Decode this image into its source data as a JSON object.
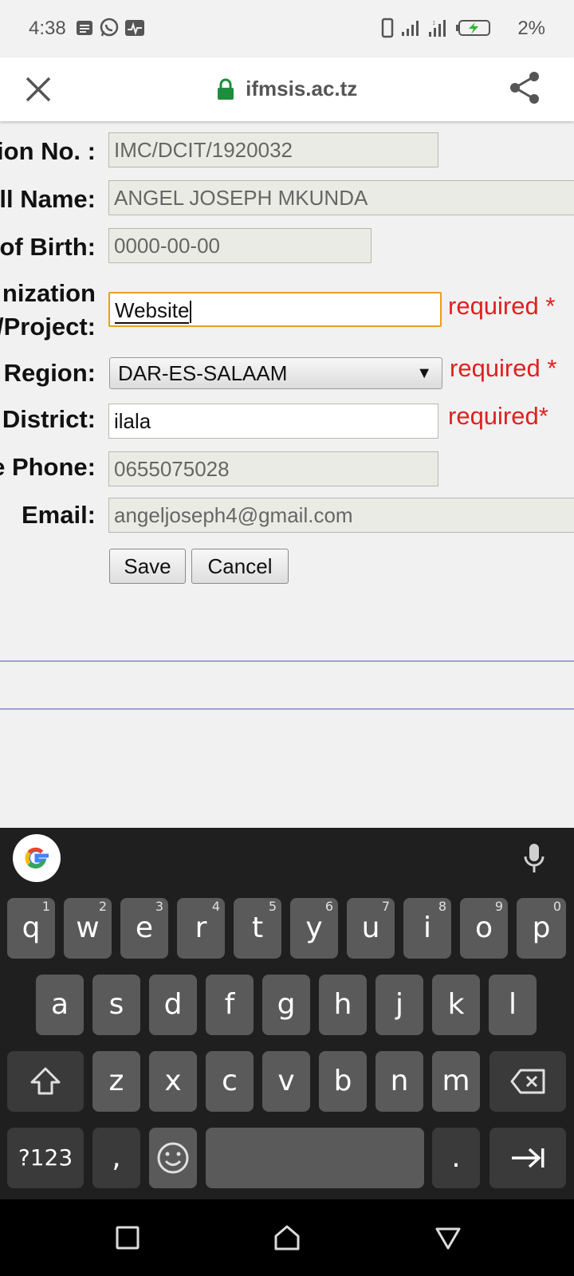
{
  "status_bar": {
    "time": "4:38",
    "battery": "2%",
    "left_icons": [
      "notes-icon",
      "whatsapp-icon",
      "activity-icon"
    ],
    "right_icons": [
      "phone-icon",
      "signal-icon",
      "signal2-icon",
      "battery-charging-icon"
    ]
  },
  "toolbar": {
    "url": "ifmsis.ac.tz",
    "lock_color": "#1e8e3e"
  },
  "form": {
    "fields": [
      {
        "label": "ion No. :",
        "value": "IMC/DCIT/1920032"
      },
      {
        "label": "ll Name:",
        "value": "ANGEL JOSEPH MKUNDA"
      },
      {
        "label": "of Birth:",
        "value": "0000-00-00"
      },
      {
        "label_line1": "nization",
        "label_line2": "/Project:",
        "value": "Website",
        "required": "required *"
      },
      {
        "label": "Region:",
        "value": "DAR-ES-SALAAM",
        "required": "required *"
      },
      {
        "label": "District:",
        "value": "ilala",
        "required": "required*"
      },
      {
        "label": "e Phone:",
        "value": "0655075028"
      },
      {
        "label": "Email:",
        "value": "angeljoseph4@gmail.com"
      }
    ],
    "save_label": "Save",
    "cancel_label": "Cancel",
    "required_color": "#e02020"
  },
  "keyboard": {
    "row1": [
      {
        "k": "q",
        "n": "1"
      },
      {
        "k": "w",
        "n": "2"
      },
      {
        "k": "e",
        "n": "3"
      },
      {
        "k": "r",
        "n": "4"
      },
      {
        "k": "t",
        "n": "5"
      },
      {
        "k": "y",
        "n": "6"
      },
      {
        "k": "u",
        "n": "7"
      },
      {
        "k": "i",
        "n": "8"
      },
      {
        "k": "o",
        "n": "9"
      },
      {
        "k": "p",
        "n": "0"
      }
    ],
    "row2": [
      "a",
      "s",
      "d",
      "f",
      "g",
      "h",
      "j",
      "k",
      "l"
    ],
    "row3": [
      "z",
      "x",
      "c",
      "v",
      "b",
      "n",
      "m"
    ],
    "symbols_label": "?123",
    "comma_label": ",",
    "period_label": "."
  }
}
